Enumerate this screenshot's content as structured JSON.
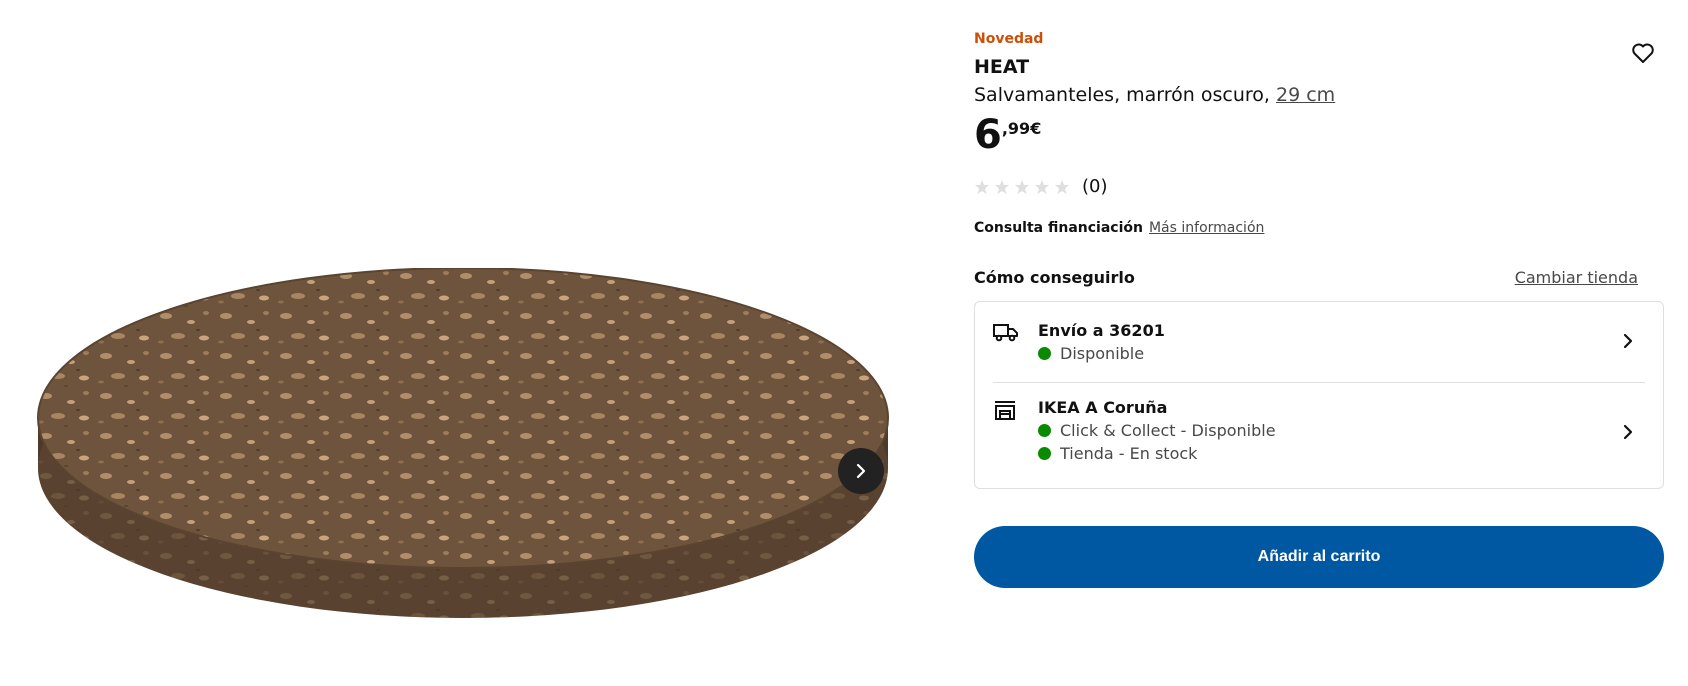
{
  "gallery": {
    "next_icon": "chevron-right-icon"
  },
  "product": {
    "badge": "Novedad",
    "name": "HEAT",
    "description": "Salvamanteles, marrón oscuro, ",
    "size_link": "29 cm",
    "price_int": "6",
    "price_dec": ",99€",
    "favorite_icon": "heart-icon",
    "rating": {
      "stars_filled": 0,
      "stars_total": 5,
      "reviews": "(0)"
    }
  },
  "finance": {
    "label": "Consulta financiación",
    "link": "Más información"
  },
  "availability": {
    "title": "Cómo conseguirlo",
    "change_store": "Cambiar tienda",
    "delivery": {
      "icon": "truck-icon",
      "title": "Envío a 36201",
      "status": "Disponible"
    },
    "store": {
      "icon": "store-icon",
      "title": "IKEA A Coruña",
      "status_1": "Click & Collect - Disponible",
      "status_2": "Tienda - En stock"
    },
    "status_color": "#0a8a00"
  },
  "actions": {
    "add_to_cart": "Añadir al carrito",
    "primary_color": "#0058a3"
  }
}
